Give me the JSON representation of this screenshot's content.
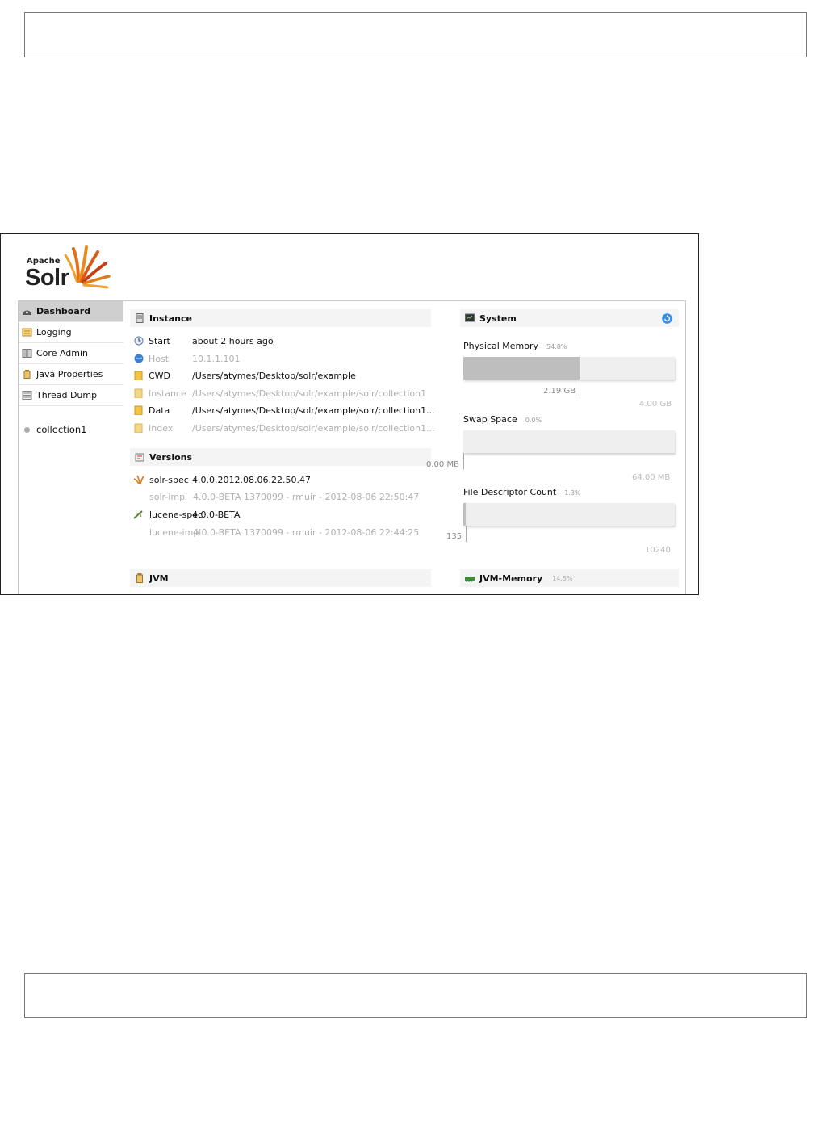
{
  "app": {
    "brand_small": "Apache",
    "brand_large": "Solr"
  },
  "sidebar": {
    "items": [
      {
        "label": "Dashboard",
        "icon": "dashboard-icon"
      },
      {
        "label": "Logging",
        "icon": "logging-icon"
      },
      {
        "label": "Core Admin",
        "icon": "core-admin-icon"
      },
      {
        "label": "Java Properties",
        "icon": "java-icon"
      },
      {
        "label": "Thread Dump",
        "icon": "thread-dump-icon"
      }
    ],
    "cores": [
      {
        "label": "collection1"
      }
    ]
  },
  "instance": {
    "title": "Instance",
    "rows": [
      {
        "label": "Start",
        "value": "about 2 hours ago",
        "icon": "clock-icon"
      },
      {
        "label": "Host",
        "value": "10.1.1.101",
        "icon": "globe-icon"
      },
      {
        "label": "CWD",
        "value": "/Users/atymes/Desktop/solr/example",
        "icon": "folder-icon"
      },
      {
        "label": "Instance",
        "value": "/Users/atymes/Desktop/solr/example/solr/collection1",
        "icon": "folder-icon"
      },
      {
        "label": "Data",
        "value": "/Users/atymes/Desktop/solr/example/solr/collection1...",
        "icon": "folder-icon"
      },
      {
        "label": "Index",
        "value": "/Users/atymes/Desktop/solr/example/solr/collection1...",
        "icon": "folder-icon"
      }
    ]
  },
  "versions": {
    "title": "Versions",
    "rows": [
      {
        "label": "solr-spec",
        "value": "4.0.0.2012.08.06.22.50.47",
        "icon": "solr-icon"
      },
      {
        "label": "solr-impl",
        "value": "4.0.0-BETA 1370099 - rmuir - 2012-08-06 22:50:47"
      },
      {
        "label": "lucene-spec",
        "value": "4.0.0-BETA",
        "icon": "lucene-icon"
      },
      {
        "label": "lucene-impl",
        "value": "4.0.0-BETA 1370099 - rmuir - 2012-08-06 22:44:25"
      }
    ]
  },
  "system": {
    "title": "System",
    "refresh_icon": "refresh-icon",
    "physical_memory": {
      "label": "Physical Memory",
      "pct": "54.8%",
      "fraction": 0.548,
      "used": "2.19 GB",
      "total": "4.00 GB"
    },
    "swap_space": {
      "label": "Swap Space",
      "pct": "0.0%",
      "fraction": 0.0,
      "used": "0.00 MB",
      "total": "64.00 MB"
    },
    "file_descriptor": {
      "label": "File Descriptor Count",
      "pct": "1.3%",
      "fraction": 0.013,
      "used": "135",
      "total": "10240"
    }
  },
  "jvm": {
    "title": "JVM"
  },
  "jvm_memory": {
    "title": "JVM-Memory",
    "pct": "14.5%"
  },
  "colors": {
    "active_nav": "#cfcfcf",
    "bar_fill": "#bebebe",
    "bar_bg": "#efefef",
    "refresh": "#3a8ee6"
  }
}
